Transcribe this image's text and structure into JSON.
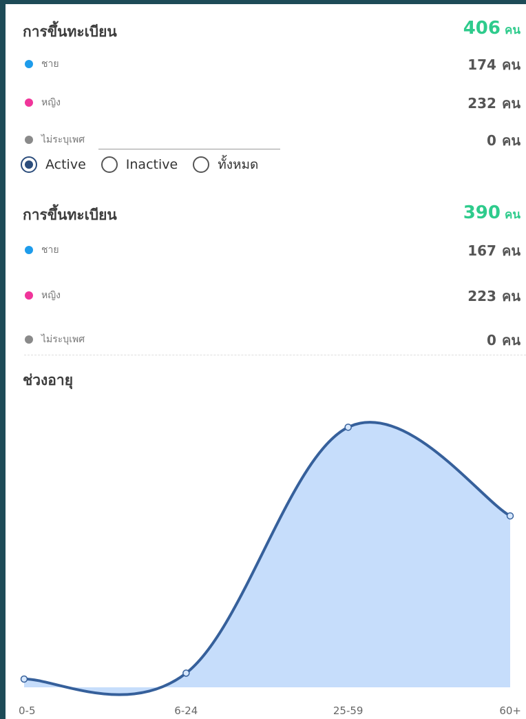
{
  "stats": [
    {
      "title": "การขึ้นทะเบียน",
      "total": "406",
      "unit": "คน",
      "rows": [
        {
          "label": "ชาย",
          "value": "174",
          "unit": "คน",
          "color": "#1e9ceb"
        },
        {
          "label": "หญิง",
          "value": "232",
          "unit": "คน",
          "color": "#f0359a"
        },
        {
          "label": "ไม่ระบุเพศ",
          "value": "0",
          "unit": "คน",
          "color": "#8a8a8a"
        }
      ]
    },
    {
      "title": "การขึ้นทะเบียน",
      "total": "390",
      "unit": "คน",
      "rows": [
        {
          "label": "ชาย",
          "value": "167",
          "unit": "คน",
          "color": "#1e9ceb"
        },
        {
          "label": "หญิง",
          "value": "223",
          "unit": "คน",
          "color": "#f0359a"
        },
        {
          "label": "ไม่ระบุเพศ",
          "value": "0",
          "unit": "คน",
          "color": "#8a8a8a"
        }
      ]
    }
  ],
  "filter": {
    "options": [
      {
        "label": "Active",
        "selected": true
      },
      {
        "label": "Inactive",
        "selected": false
      },
      {
        "label": "ทั้งหมด",
        "selected": false
      }
    ]
  },
  "age_section": {
    "title": "ช่วงอายุ"
  },
  "chart_data": {
    "type": "area",
    "categories": [
      "0-5",
      "6-24",
      "25-59",
      "60+"
    ],
    "values": [
      7,
      12,
      220,
      145
    ],
    "ylim": [
      0,
      240
    ],
    "line_color": "#36609b",
    "fill_color": "#c6ddfb",
    "grid": false
  }
}
